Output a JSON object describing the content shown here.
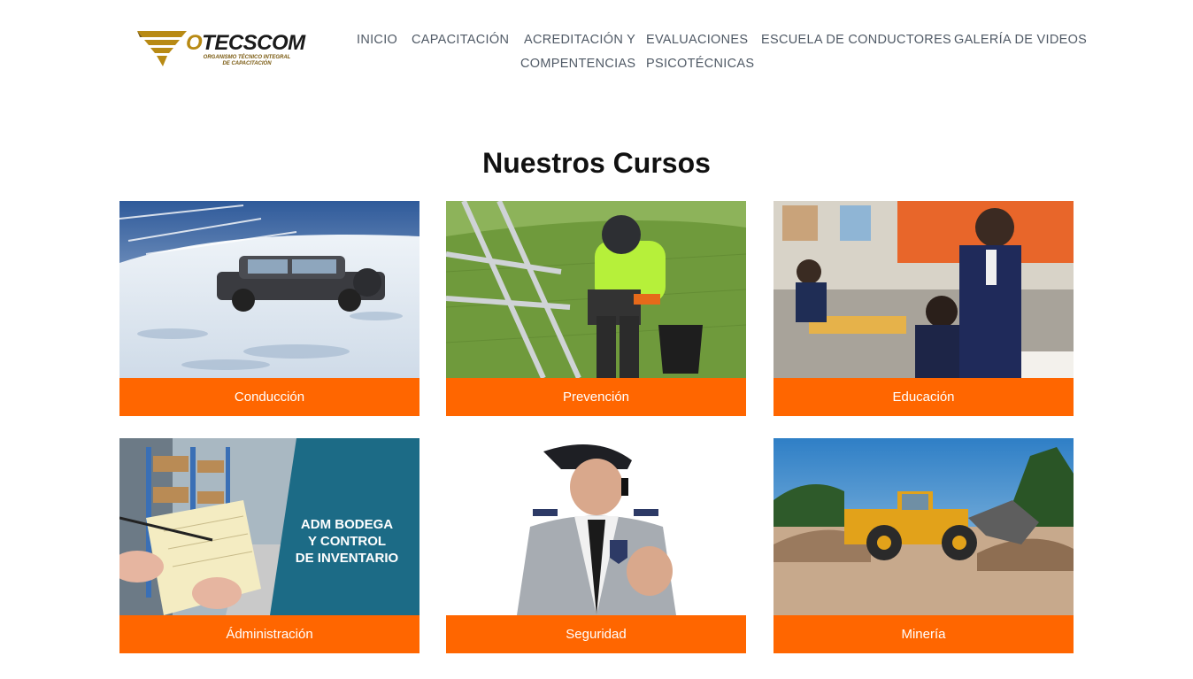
{
  "logo": {
    "name": "OTECSCOM",
    "tagline_line1": "ORGANISMO TÉCNICO INTEGRAL",
    "tagline_line2": "DE CAPACITACIÓN"
  },
  "nav": {
    "items": [
      {
        "label": "INICIO"
      },
      {
        "label": "CAPACITACIÓN"
      },
      {
        "label": "ACREDITACIÓN Y"
      },
      {
        "label": "COMPENTENCIAS"
      },
      {
        "label": "EVALUACIONES"
      },
      {
        "label": "PSICOTÉCNICAS"
      },
      {
        "label": "ESCUELA DE CONDUCTORES"
      },
      {
        "label": "GALERÍA DE VIDEOS"
      }
    ]
  },
  "courses": {
    "title": "Nuestros Cursos",
    "cards": [
      {
        "label": "Conducción"
      },
      {
        "label": "Prevención"
      },
      {
        "label": "Educación"
      },
      {
        "label": "Ádministración",
        "overlay": [
          "ADM BODEGA",
          "Y CONTROL",
          "DE INVENTARIO"
        ]
      },
      {
        "label": "Seguridad"
      },
      {
        "label": "Minería"
      }
    ]
  },
  "colors": {
    "accent": "#ff6600",
    "nav_text": "#505a66",
    "logo_gold": "#b88a14"
  }
}
